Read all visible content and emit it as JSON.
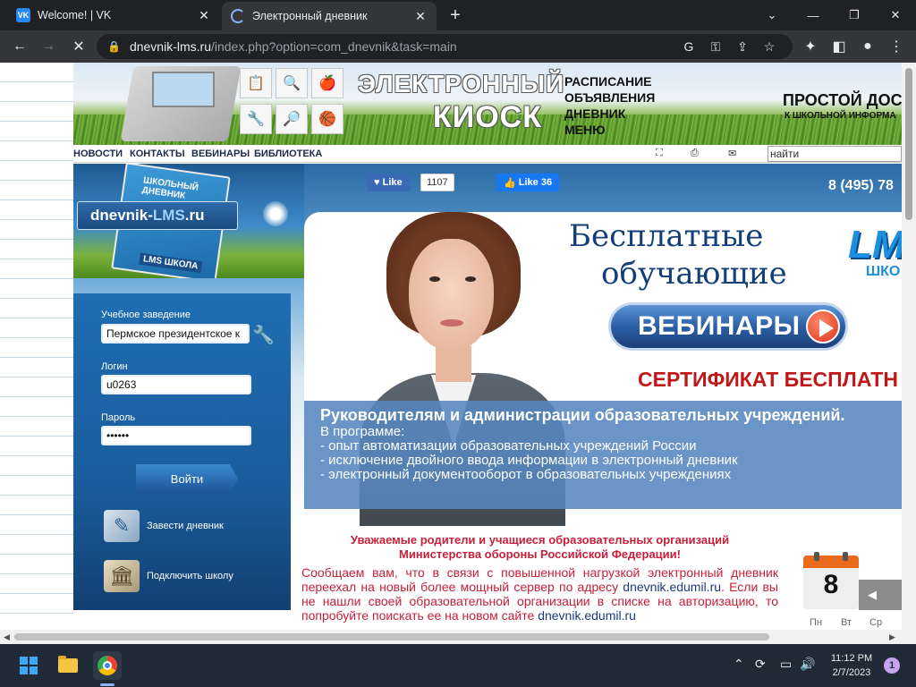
{
  "browser": {
    "tabs": [
      {
        "title": "Welcome! | VK",
        "favicon": "vk-icon",
        "favicon_text": "VK"
      },
      {
        "title": "Электронный дневник",
        "favicon": "loading-spinner-icon"
      }
    ],
    "url_host": "dnevnik-lms.ru",
    "url_path": "/index.php?option=com_dnevnik&task=main"
  },
  "banner": {
    "title_line1": "ЭЛЕКТРОННЫЙ",
    "title_line2": "КИОСК",
    "menu": [
      "РАСПИСАНИЕ",
      "ОБЪЯВЛЕНИЯ",
      "ДНЕВНИК",
      "МЕНЮ"
    ],
    "tagline": "ПРОСТОЙ ДОСТ",
    "tagline_sub": "К ШКОЛЬНОЙ ИНФОРМА"
  },
  "nav": {
    "links": [
      "НОВОСТИ",
      "КОНТАКТЫ",
      "ВЕБИНАРЫ",
      "БИБЛИОТЕКА"
    ],
    "search_value": "найти"
  },
  "hero": {
    "book_title": "ШКОЛЬНЫЙ ДНЕВНИК",
    "book_sub": "LMS ШКОЛА",
    "site_badge_main": "dnevnik-",
    "site_badge_accent": "LMS",
    "site_badge_tail": ".ru",
    "vk_like": "Like",
    "vk_like_count": "1107",
    "fb_like": "Like 36",
    "phone": "8 (495) 78"
  },
  "promo": {
    "title_line1": "Бесплатные",
    "title_line2": "обучающие",
    "webinar_button": "ВЕБИНАРЫ",
    "lms_logo": "LM",
    "lms_logo_sub": "ШКО",
    "certificate": "СЕРТИФИКАТ БЕСПЛАТН",
    "info_head": "Руководителям и администрации образовательных учреждений.",
    "info_lines": [
      "В программе:",
      "- опыт автоматизации образовательных учреждений России",
      "- исключение двойного ввода информации в электронный дневник",
      "- электронный документооборот в образовательных учреждениях"
    ]
  },
  "login": {
    "school_label": "Учебное заведение",
    "school_value": "Пермское президентское к",
    "login_label": "Логин",
    "login_value": "u0263",
    "password_label": "Пароль",
    "password_value": "••••••",
    "submit": "Войти",
    "link_diary": "Завести дневник",
    "link_school": "Подключить школу"
  },
  "notice": {
    "heading_line1": "Уважаемые родители и учащиеся образовательных организаций",
    "heading_line2": "Министерства обороны Российской Федерации!",
    "body_part1": "Сообщаем вам, что в связи с повышенной нагрузкой электронный дневник переехал на новый более мощный сервер по адресу ",
    "body_link1": "dnevnik.edumil.ru",
    "body_part2": ". Если вы не нашли своей образовательной организации в списке на авторизацию, то попробуйте поискать ее на новом сайте ",
    "body_link2": "dnevnik.edumil.ru"
  },
  "calendar": {
    "day": "8",
    "weekdays": [
      "Пн",
      "Вт",
      "Ср"
    ]
  },
  "taskbar": {
    "time": "11:12 PM",
    "date": "2/7/2023",
    "notifications": "1"
  },
  "colors": {
    "chrome_dark": "#202124",
    "chrome_toolbar": "#35363a",
    "site_navy": "#123e7a",
    "notice_red": "#c8203a",
    "login_blue": "#1f6db3"
  }
}
